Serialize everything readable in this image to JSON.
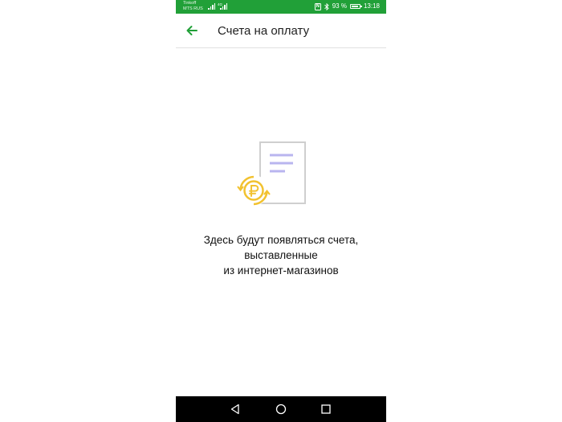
{
  "status_bar": {
    "carrier_1": "Tinkoff",
    "carrier_2": "MTS RUS",
    "network_type": "4G",
    "battery_percent": "93 %",
    "battery_level": 0.93,
    "time": "13:18",
    "icons": [
      "signal-icon",
      "nfc-icon",
      "bluetooth-icon",
      "battery-icon"
    ],
    "color": "#21a038"
  },
  "app_bar": {
    "title": "Счета на оплату",
    "back_icon": "arrow-left-icon",
    "accent_color": "#21a038"
  },
  "empty_state": {
    "illustration": "invoice-with-ruble-coin",
    "message_lines": [
      "Здесь будут появляться счета,",
      "выставленные",
      "из интернет-магазинов"
    ],
    "coin_color": "#f2c230",
    "document_lines_color": "#b9b5ef"
  },
  "nav_bar": {
    "buttons": [
      "back-triangle-icon",
      "home-circle-icon",
      "recents-square-icon"
    ]
  }
}
